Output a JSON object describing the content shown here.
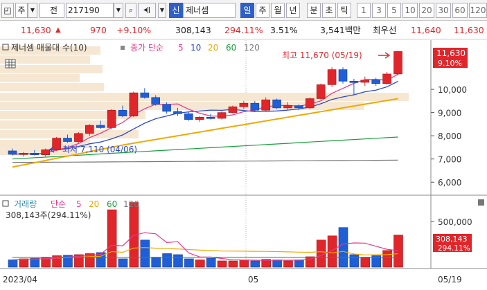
{
  "toolbar": {
    "market": "주",
    "type_label": "전",
    "code": "217190",
    "credit_badge": "신",
    "stock_name": "제너셈",
    "periods": [
      "일",
      "주",
      "월",
      "년",
      "분",
      "초",
      "틱"
    ],
    "active_period": "일",
    "intervals": [
      "1",
      "3",
      "5",
      "10",
      "20",
      "30",
      "60",
      "120"
    ]
  },
  "quote": {
    "price": "11,630",
    "change_arrow": "▲",
    "change": "970",
    "change_pct": "+9.10%",
    "volume": "308,143",
    "volume_ratio": "294.11%",
    "turnover": "3.51%",
    "trade_value": "3,541백만",
    "best_ask_label": "최우선",
    "ask": "11,640",
    "bid": "11,630"
  },
  "chart": {
    "price_panel": {
      "legend_title": "제너셈 매물대 수(10)",
      "ma_label": "종가 단순",
      "ma_periods": [
        "5",
        "10",
        "20",
        "60",
        "120"
      ],
      "ma_colors": [
        "#e8388b",
        "#2e47c9",
        "#f0a800",
        "#1a9e3c",
        "#777777"
      ],
      "high_label": "최고 11,670 (05/19)",
      "low_label": "최저 7,110 (04/06)",
      "y_ticks": [
        "10,000",
        "9,000",
        "8,000",
        "7,000",
        "6,000"
      ],
      "last_price_tag": "11,630",
      "last_pct_tag": "9.10%"
    },
    "volume_panel": {
      "title": "거래량",
      "ma_label": "단순",
      "ma_periods": [
        "5",
        "20",
        "60",
        "120"
      ],
      "current": "308,143주(294.11%)",
      "y_ticks": [
        "500,000"
      ],
      "last_volume_tag": "308,143",
      "last_pct_tag": "294.11%"
    },
    "x_labels": [
      "2023/04",
      "05",
      "05/19"
    ]
  },
  "chart_data": {
    "type": "candlestick",
    "dates_range": [
      "2023/04",
      "05/19"
    ],
    "ohlc": [
      [
        7350,
        7450,
        7150,
        7200
      ],
      [
        7200,
        7300,
        7100,
        7250
      ],
      [
        7250,
        7380,
        7150,
        7180
      ],
      [
        7180,
        7450,
        7110,
        7400
      ],
      [
        7400,
        7950,
        7350,
        7900
      ],
      [
        7900,
        8050,
        7700,
        7750
      ],
      [
        7750,
        8150,
        7700,
        8100
      ],
      [
        8100,
        8500,
        8000,
        8450
      ],
      [
        8450,
        8650,
        8300,
        8350
      ],
      [
        8350,
        9150,
        8300,
        9100
      ],
      [
        9100,
        9300,
        8800,
        8850
      ],
      [
        8850,
        9900,
        8800,
        9850
      ],
      [
        9850,
        10050,
        9600,
        9650
      ],
      [
        9650,
        9750,
        9300,
        9350
      ],
      [
        9350,
        9450,
        8950,
        9050
      ],
      [
        9050,
        9200,
        8850,
        8950
      ],
      [
        8950,
        9050,
        8650,
        8700
      ],
      [
        8700,
        8850,
        8600,
        8800
      ],
      [
        8800,
        8950,
        8700,
        8750
      ],
      [
        8750,
        9050,
        8700,
        9000
      ],
      [
        9000,
        9300,
        8950,
        9250
      ],
      [
        9250,
        9500,
        9150,
        9400
      ],
      [
        9400,
        9500,
        9050,
        9100
      ],
      [
        9100,
        9650,
        9050,
        9550
      ],
      [
        9550,
        9600,
        9150,
        9200
      ],
      [
        9200,
        9450,
        9100,
        9300
      ],
      [
        9300,
        9350,
        9100,
        9200
      ],
      [
        9200,
        9650,
        9150,
        9600
      ],
      [
        9600,
        10250,
        9550,
        10200
      ],
      [
        10200,
        10950,
        10100,
        10850
      ],
      [
        10850,
        10950,
        10250,
        10350
      ],
      [
        10350,
        10450,
        9750,
        10300
      ],
      [
        10300,
        10550,
        10150,
        10400
      ],
      [
        10400,
        10500,
        10150,
        10250
      ],
      [
        10250,
        10750,
        10200,
        10660
      ],
      [
        10660,
        11670,
        10600,
        11630
      ]
    ],
    "volume": [
      70000,
      80000,
      85000,
      90000,
      110000,
      115000,
      120000,
      130000,
      140000,
      550000,
      80000,
      620000,
      260000,
      90000,
      130000,
      120000,
      80000,
      70000,
      85000,
      60000,
      60000,
      70000,
      60000,
      75000,
      70000,
      60000,
      70000,
      100000,
      260000,
      300000,
      380000,
      120000,
      90000,
      110000,
      160000,
      308143
    ],
    "ylim_price": [
      5500,
      12000
    ],
    "ylim_volume": [
      0,
      650000
    ]
  }
}
